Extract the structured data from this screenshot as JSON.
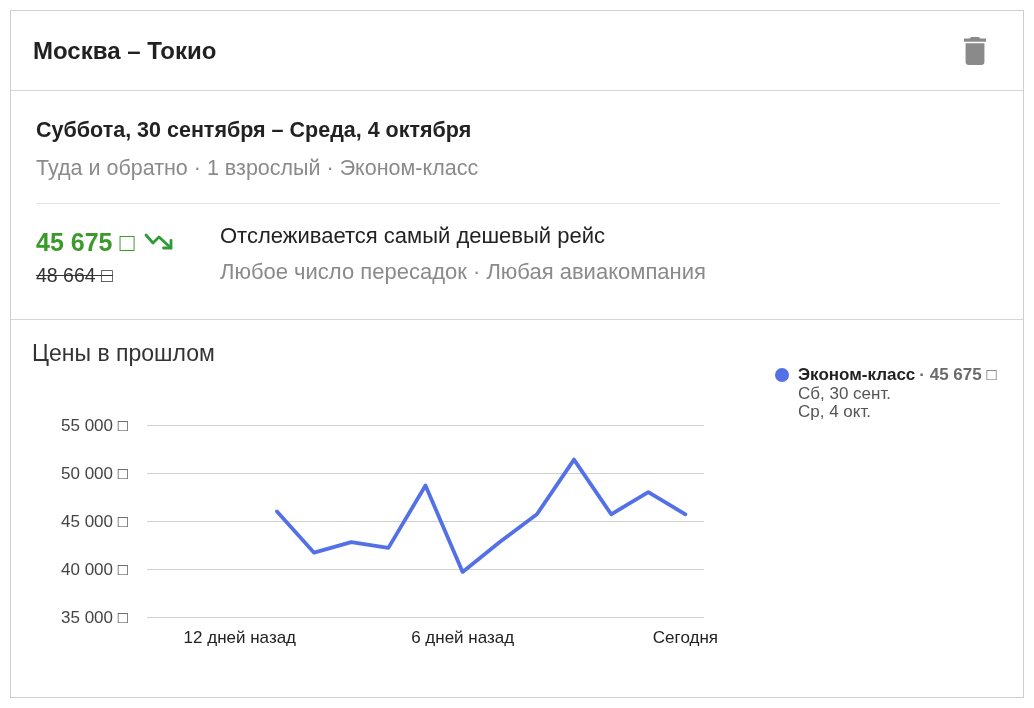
{
  "card": {
    "title": "Москва – Токио"
  },
  "trip": {
    "dates": "Суббота, 30 сентября – Среда, 4 октября",
    "details": "Туда и обратно · 1 взрослый · Эконом-класс"
  },
  "price": {
    "current": "45 675 □",
    "previous": "48 664 □",
    "falling": true
  },
  "tracking": {
    "title": "Отслеживается самый дешевый рейс",
    "filters": "Любое число пересадок · Любая авиакомпания"
  },
  "history": {
    "title": "Цены в прошлом",
    "chart_data": {
      "type": "line",
      "grid": true,
      "x": [
        -11,
        -10,
        -9,
        -8,
        -7,
        -6,
        -5,
        -4,
        -3,
        -2,
        -1,
        0
      ],
      "xlim": [
        -14.5,
        0.5
      ],
      "ylim": [
        35000,
        55000
      ],
      "xticks": [
        {
          "value": -12,
          "label": "12 дней назад"
        },
        {
          "value": -6,
          "label": "6 дней назад"
        },
        {
          "value": 0,
          "label": "Сегодня"
        }
      ],
      "yticks": [
        {
          "value": 55000,
          "label": "55 000 □"
        },
        {
          "value": 50000,
          "label": "50 000 □"
        },
        {
          "value": 45000,
          "label": "45 000 □"
        },
        {
          "value": 40000,
          "label": "40 000 □"
        },
        {
          "value": 35000,
          "label": "35 000 □"
        }
      ],
      "series": [
        {
          "name": "Эконом-класс",
          "color": "#5370e6",
          "values": [
            46000,
            41700,
            42800,
            42200,
            48700,
            39700,
            42800,
            45700,
            51400,
            45700,
            48000,
            45700
          ]
        }
      ]
    },
    "legend": {
      "price": "· 45 675 □",
      "lines": [
        "Сб, 30 сент.",
        "Ср, 4 окт."
      ]
    }
  }
}
